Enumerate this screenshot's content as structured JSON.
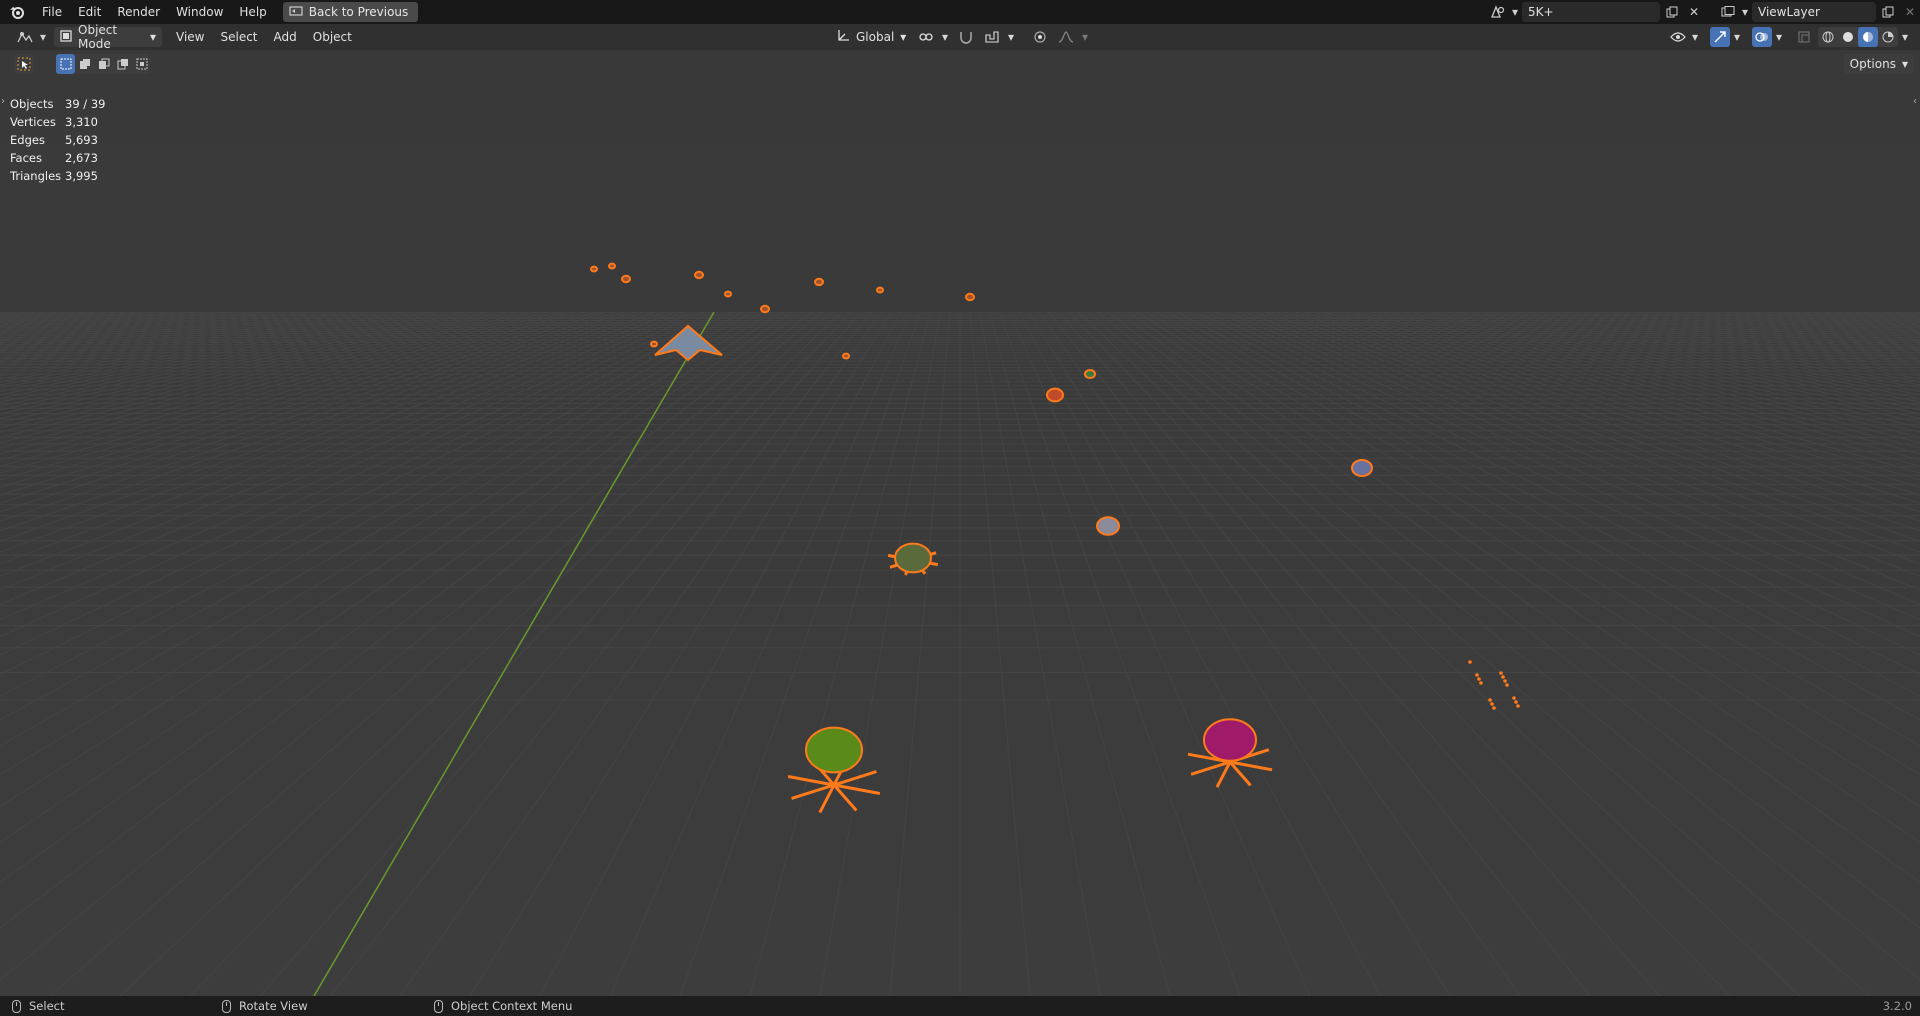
{
  "menubar": {
    "items": [
      "File",
      "Edit",
      "Render",
      "Window",
      "Help"
    ],
    "back_button": "Back to Previous",
    "scene_name": "5K+",
    "view_layer": "ViewLayer"
  },
  "header": {
    "mode": "Object Mode",
    "menus": [
      "View",
      "Select",
      "Add",
      "Object"
    ],
    "orientation": "Global"
  },
  "toolsettings": {
    "options_label": "Options"
  },
  "stats": [
    {
      "label": "Objects",
      "value": "39 / 39"
    },
    {
      "label": "Vertices",
      "value": "3,310"
    },
    {
      "label": "Edges",
      "value": "5,693"
    },
    {
      "label": "Faces",
      "value": "2,673"
    },
    {
      "label": "Triangles",
      "value": "3,995"
    }
  ],
  "statusbar": {
    "select": "Select",
    "rotate": "Rotate View",
    "context": "Object Context Menu",
    "version": "3.2.0"
  },
  "colors": {
    "selection_outline": "#ff7a1a",
    "y_axis": "#6a9a2a",
    "active_blue": "#4772b3"
  }
}
